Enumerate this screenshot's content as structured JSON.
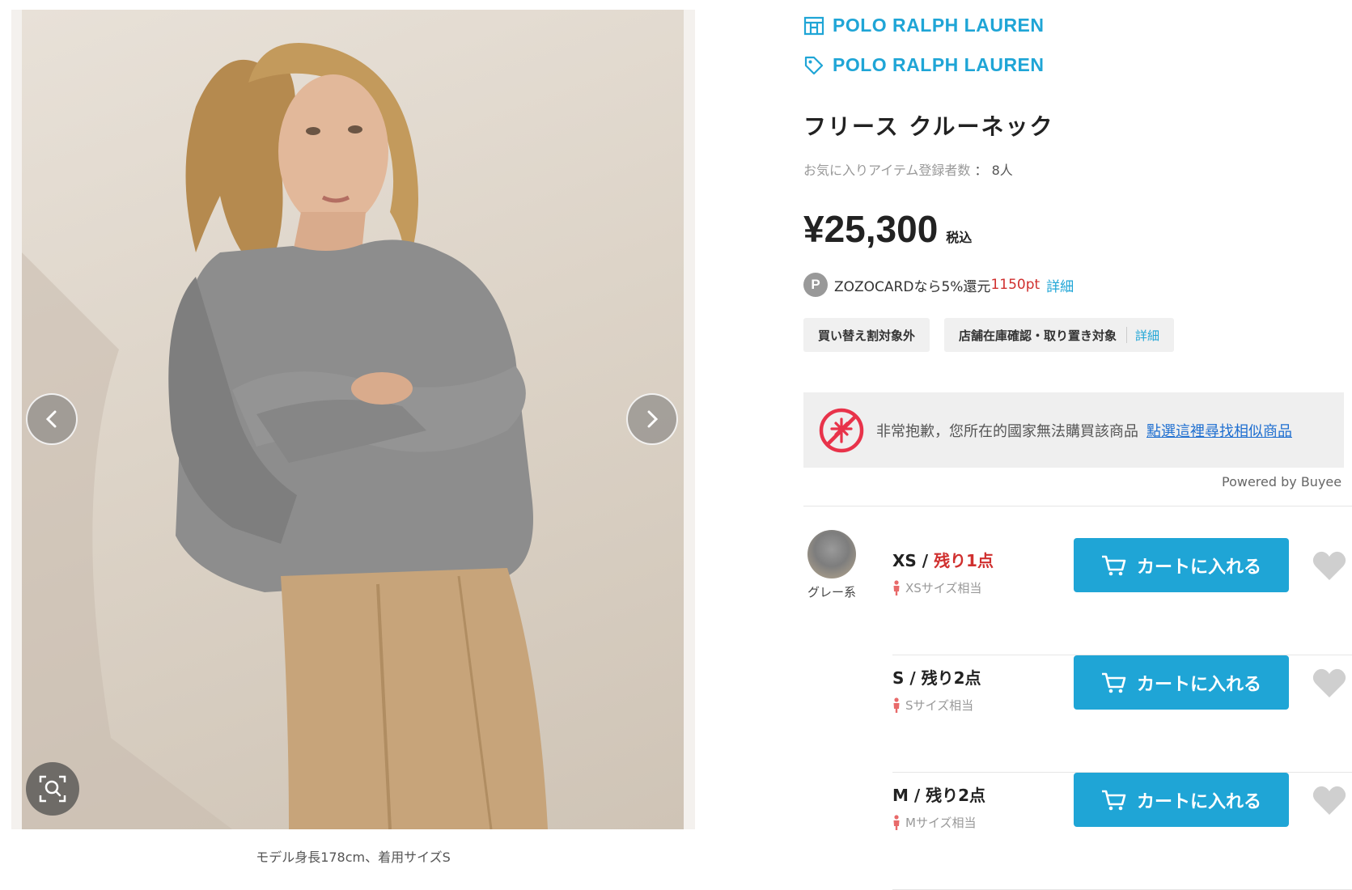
{
  "gallery": {
    "caption": "モデル身長178cm、着用サイズS"
  },
  "brand": {
    "shop_name": "POLO RALPH LAUREN",
    "brand_name": "POLO RALPH LAUREN"
  },
  "product": {
    "title": "フリース クルーネック",
    "favorites_label": "お気に入りアイテム登録者数",
    "favorites_sep": "：",
    "favorites_count": "8人",
    "price": "¥25,300",
    "tax_label": "税込"
  },
  "points": {
    "badge": "P",
    "text": "ZOZOCARDなら5%還元",
    "pt": "1150pt",
    "detail": "詳細"
  },
  "tags": {
    "trade_in": "買い替え割対象外",
    "store_stock": "店舗在庫確認・取り置き対象",
    "store_stock_detail": "詳細"
  },
  "notice": {
    "message": "非常抱歉，您所在的國家無法購買該商品",
    "link": "點選這裡尋找相似商品",
    "powered": "Powered by Buyee"
  },
  "color": {
    "name": "グレー系"
  },
  "sizes": [
    {
      "size": "XS",
      "sep": " / ",
      "stock": "残り1点",
      "fit": "XSサイズ相当",
      "button": "カートに入れる",
      "low_stock": true
    },
    {
      "size": "S",
      "sep": " / ",
      "stock": "残り2点",
      "fit": "Sサイズ相当",
      "button": "カートに入れる",
      "low_stock": false
    },
    {
      "size": "M",
      "sep": " / ",
      "stock": "残り2点",
      "fit": "Mサイズ相当",
      "button": "カートに入れる",
      "low_stock": false
    }
  ],
  "colors": {
    "accent": "#1fa5d6",
    "alert": "#d0302f"
  }
}
